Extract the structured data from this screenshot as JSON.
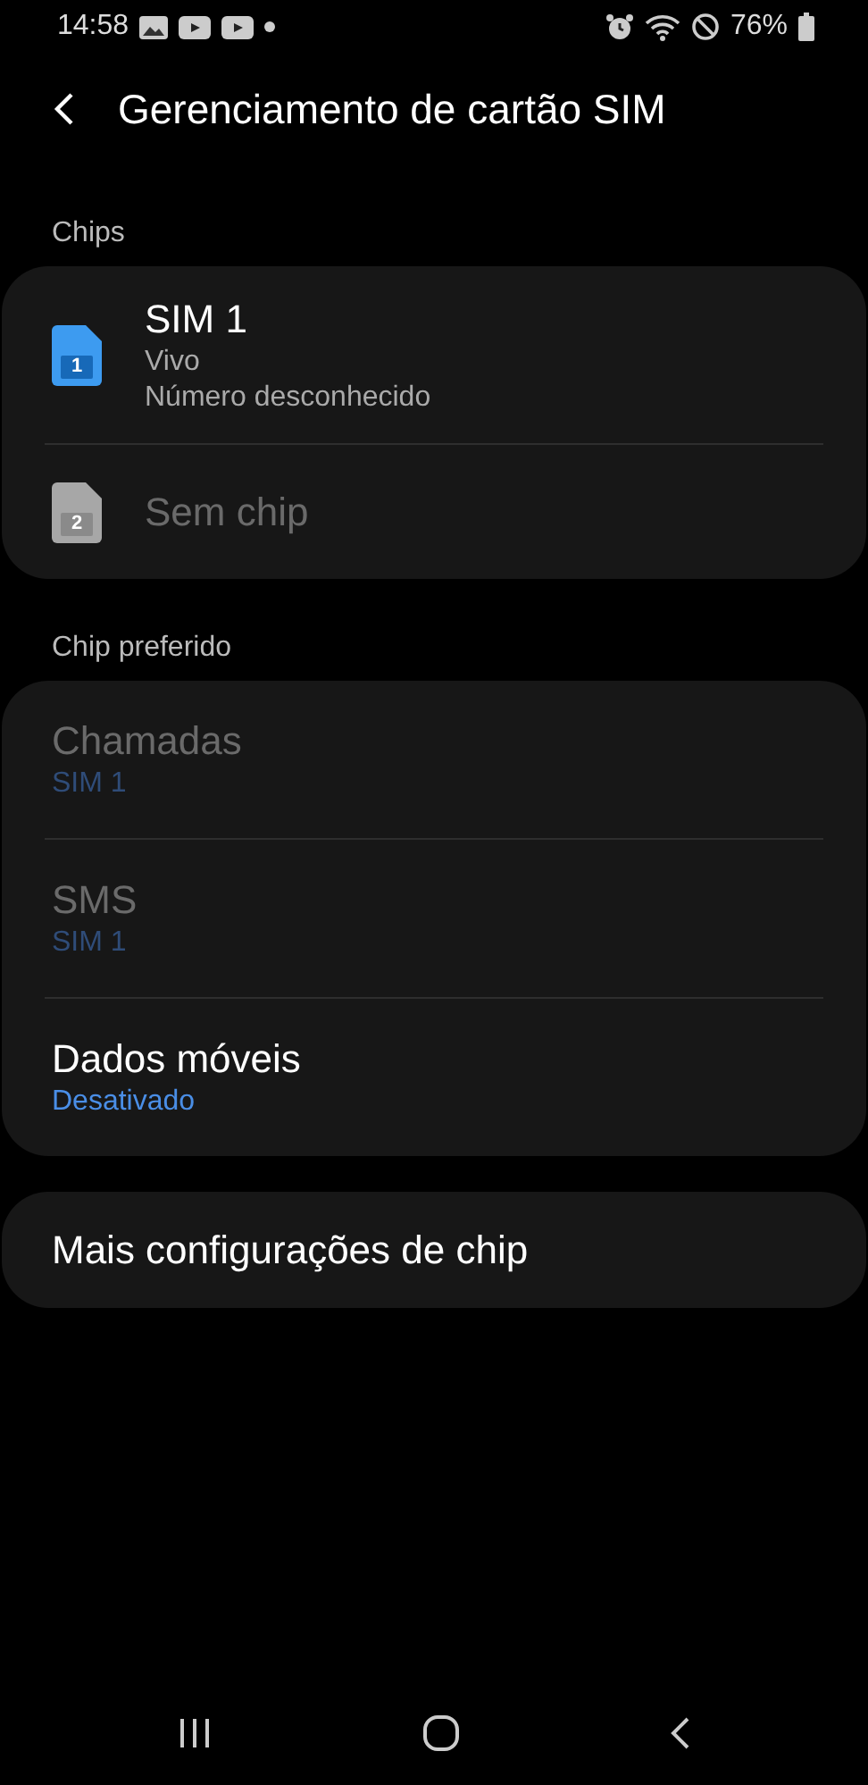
{
  "status_bar": {
    "time": "14:58",
    "battery": "76%"
  },
  "header": {
    "title": "Gerenciamento de cartão SIM"
  },
  "chips_section": {
    "title": "Chips",
    "items": [
      {
        "slot": "1",
        "name": "SIM 1",
        "lines": [
          "Vivo",
          "Número desconhecido"
        ],
        "disabled": false
      },
      {
        "slot": "2",
        "name": "Sem chip",
        "disabled": true
      }
    ]
  },
  "preferred_section": {
    "title": "Chip preferido",
    "items": [
      {
        "label": "Chamadas",
        "value": "SIM 1",
        "disabled": true
      },
      {
        "label": "SMS",
        "value": "SIM 1",
        "disabled": true
      },
      {
        "label": "Dados móveis",
        "value": "Desativado",
        "disabled": false
      }
    ]
  },
  "more_settings": {
    "label": "Mais configurações de chip"
  }
}
